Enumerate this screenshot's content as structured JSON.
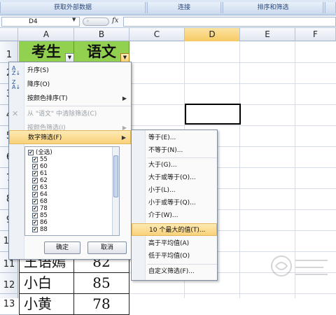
{
  "ribbon": {
    "groups": [
      "获取外部数据",
      "连接",
      "排序和筛选"
    ]
  },
  "formula_bar": {
    "name_box": "D4",
    "fx_label": "fx",
    "formula": ""
  },
  "columns": [
    "A",
    "B",
    "C",
    "D",
    "E",
    "F"
  ],
  "selected_column": "D",
  "rows": [
    "1",
    "2",
    "3",
    "4",
    "5",
    "6",
    "7",
    "8",
    "9",
    "10",
    "11",
    "12",
    "13"
  ],
  "cells": {
    "A1": "考生",
    "B1": "语文",
    "A11": "王语嫣",
    "B11": "82",
    "A12": "小白",
    "B12": "85",
    "A13": "小黄",
    "B13": "78"
  },
  "filter_menu": {
    "items": [
      {
        "label": "升序(S)",
        "icon": "sort-ascending-icon",
        "disabled": false
      },
      {
        "label": "降序(O)",
        "icon": "sort-descending-icon",
        "disabled": false
      },
      {
        "label": "按颜色排序(T)",
        "disabled": false
      },
      {
        "label": "从 \"语文\" 中清除筛选(C)",
        "icon": "clear-filter-icon",
        "disabled": true
      },
      {
        "label": "按颜色筛选(I)",
        "disabled": true
      },
      {
        "label": "数字筛选(F)",
        "disabled": false
      }
    ],
    "checklist": [
      "(全选)",
      "55",
      "60",
      "61",
      "62",
      "63",
      "64",
      "68",
      "78",
      "85",
      "86",
      "88"
    ],
    "ok_label": "确定",
    "cancel_label": "取消"
  },
  "number_filters": {
    "items": [
      "等于(E)...",
      "不等于(N)...",
      "大于(G)...",
      "大于或等于(O)...",
      "小于(L)...",
      "小于或等于(Q)...",
      "介于(W)...",
      "10 个最大的值(T)...",
      "高于平均值(A)",
      "低于平均值(O)",
      "自定义筛选(F)..."
    ],
    "highlighted": "10 个最大的值(T)..."
  },
  "colors": {
    "header_fill": "#92d050",
    "highlight": "#f9d17a"
  }
}
